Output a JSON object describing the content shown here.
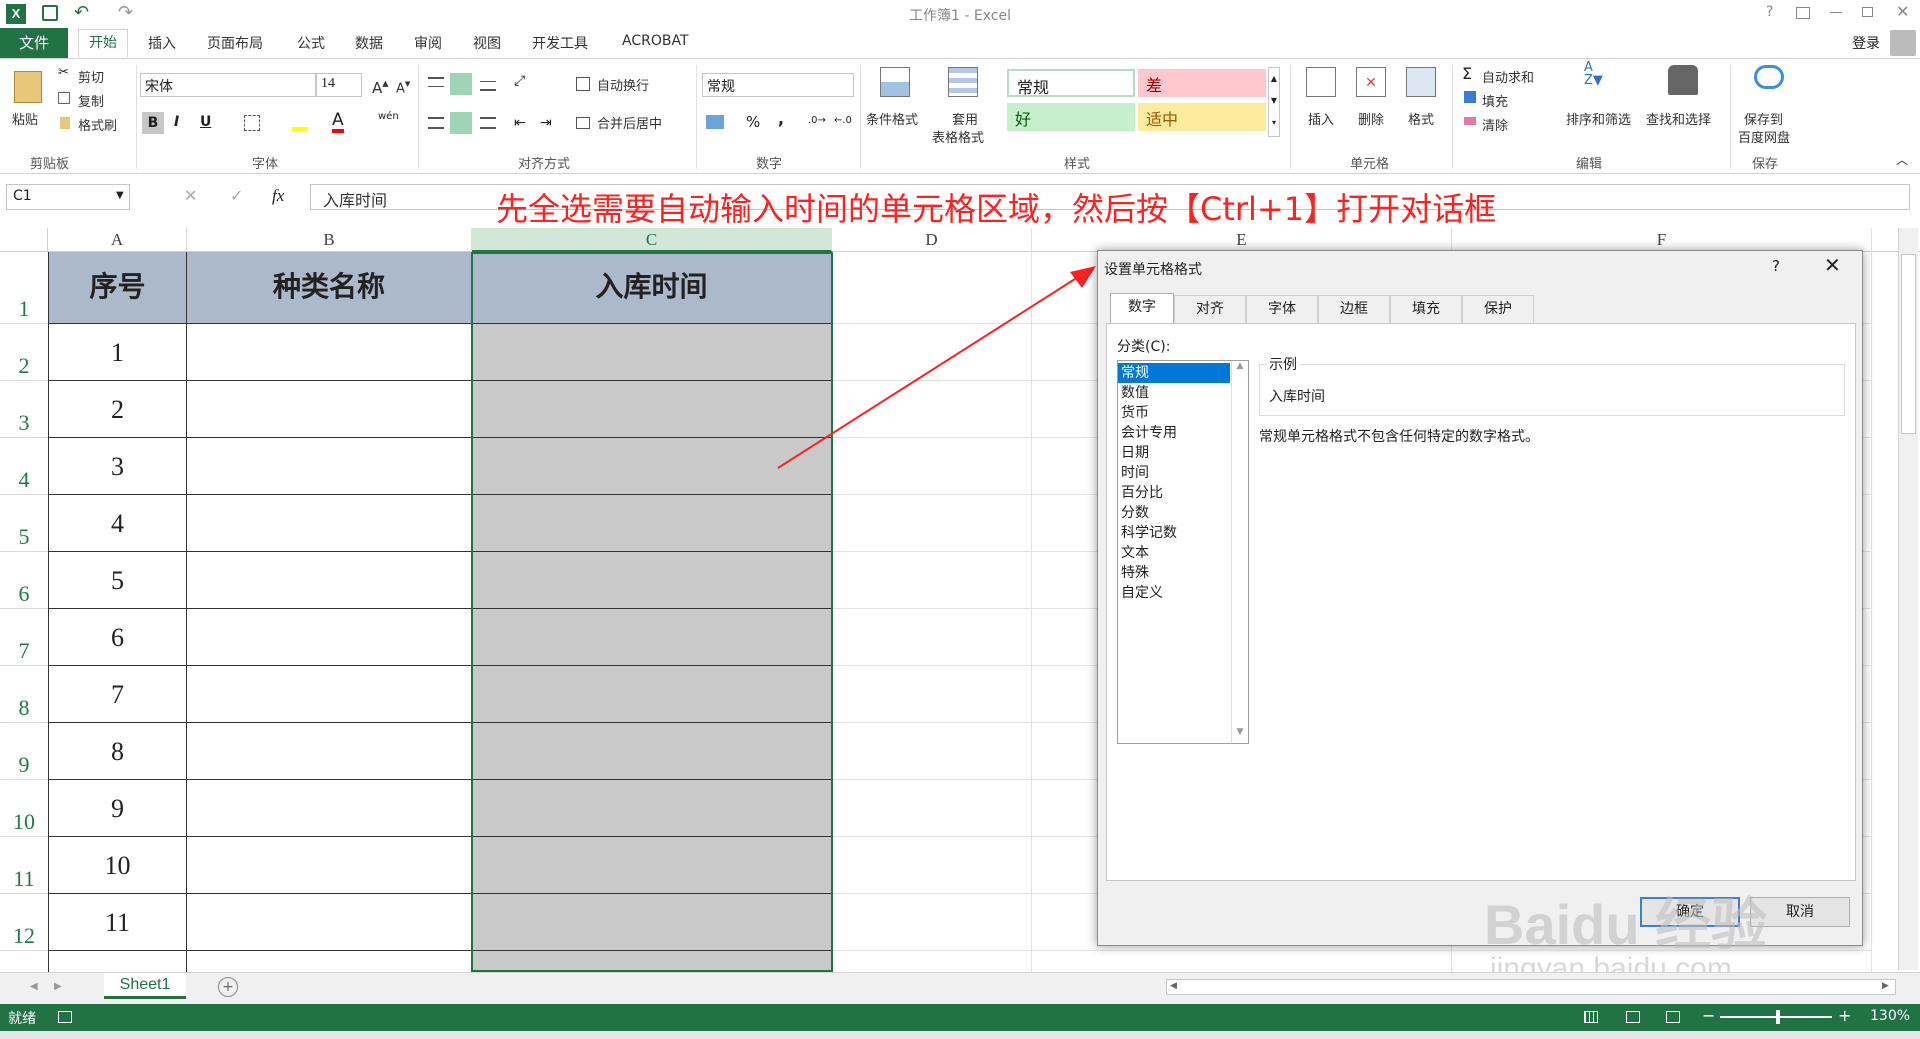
{
  "window": {
    "title": "工作簿1 - Excel",
    "login": "登录",
    "help": "?"
  },
  "ribbon_tabs": [
    "文件",
    "开始",
    "插入",
    "页面布局",
    "公式",
    "数据",
    "审阅",
    "视图",
    "开发工具",
    "ACROBAT"
  ],
  "clipboard": {
    "paste": "粘贴",
    "cut": "剪切",
    "copy": "复制",
    "format_painter": "格式刷",
    "label": "剪贴板"
  },
  "font": {
    "name": "宋体",
    "size": "14",
    "label": "字体",
    "bold": "B",
    "italic": "I",
    "underline": "U",
    "wen": "wén"
  },
  "alignment": {
    "wrap_text": "自动换行",
    "merge_center": "合并后居中",
    "label": "对齐方式"
  },
  "number": {
    "format": "常规",
    "percent": "%",
    "comma": ",",
    "label": "数字"
  },
  "styles": {
    "conditional": "条件格式",
    "table_format_1": "套用",
    "table_format_2": "表格格式",
    "normal": "常规",
    "bad": "差",
    "good": "好",
    "neutral": "适中",
    "label": "样式"
  },
  "cells": {
    "insert": "插入",
    "delete": "删除",
    "format": "格式",
    "label": "单元格"
  },
  "editing": {
    "autosum": "自动求和",
    "fill": "填充",
    "clear": "清除",
    "sort_filter": "排序和筛选",
    "find_select": "查找和选择",
    "label": "编辑"
  },
  "save": {
    "btn_1": "保存到",
    "btn_2": "百度网盘",
    "label": "保存"
  },
  "formula_bar": {
    "name_box": "C1",
    "fx": "fx",
    "content": "入库时间"
  },
  "annotation": "先全选需要自动输入时间的单元格区域，然后按【Ctrl+1】打开对话框",
  "columns": [
    "A",
    "B",
    "C",
    "D",
    "E",
    "F"
  ],
  "rows": [
    "1",
    "2",
    "3",
    "4",
    "5",
    "6",
    "7",
    "8",
    "9",
    "10",
    "11",
    "12"
  ],
  "table": {
    "headers": [
      "序号",
      "种类名称",
      "入库时间"
    ],
    "seq": [
      "1",
      "2",
      "3",
      "4",
      "5",
      "6",
      "7",
      "8",
      "9",
      "10",
      "11"
    ]
  },
  "dialog": {
    "title": "设置单元格格式",
    "help": "?",
    "tabs": [
      "数字",
      "对齐",
      "字体",
      "边框",
      "填充",
      "保护"
    ],
    "category_label": "分类(C):",
    "categories": [
      "常规",
      "数值",
      "货币",
      "会计专用",
      "日期",
      "时间",
      "百分比",
      "分数",
      "科学记数",
      "文本",
      "特殊",
      "自定义"
    ],
    "sample_label": "示例",
    "sample_value": "入库时间",
    "description": "常规单元格格式不包含任何特定的数字格式。",
    "ok": "确定",
    "cancel": "取消"
  },
  "sheet_tabs": [
    "Sheet1"
  ],
  "status": {
    "ready": "就绪",
    "zoom": "130%"
  },
  "watermark": {
    "brand": "Baidu 经验",
    "url": "jingyan.baidu.com"
  },
  "colors": {
    "excel_green": "#217346",
    "header_fill": "#acb9ca",
    "selection_fill": "#c9c9c9",
    "annotation_red": "#ff2020"
  }
}
